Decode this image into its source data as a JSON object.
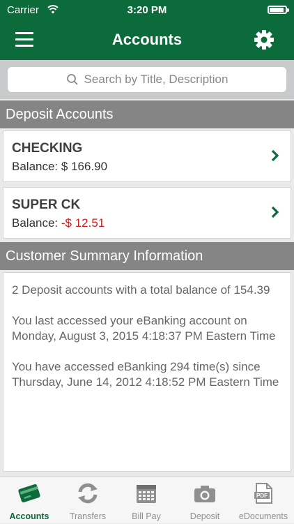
{
  "status_bar": {
    "carrier": "Carrier",
    "time": "3:20 PM",
    "battery_level": 0.9
  },
  "nav": {
    "title": "Accounts"
  },
  "search": {
    "placeholder": "Search by Title, Description"
  },
  "sections": {
    "deposit_accounts": "Deposit Accounts",
    "customer_summary": "Customer Summary Information"
  },
  "accounts": [
    {
      "name": "CHECKING",
      "balance_label": "Balance: ",
      "balance_value": "$ 166.90"
    },
    {
      "name": "SUPER CK",
      "balance_label": "Balance: ",
      "balance_value": "-$ 12.51"
    }
  ],
  "summary": {
    "line1": "2 Deposit accounts with a total balance of 154.39",
    "line2": "You last accessed your eBanking account on Monday, August 3, 2015 4:18:37 PM Eastern Time",
    "line3": "You have accessed eBanking 294 time(s) since Thursday, June 14, 2012 4:18:52 PM Eastern Time"
  },
  "tabs": [
    {
      "label": "Accounts",
      "icon": "accounts-card-icon",
      "active": true
    },
    {
      "label": "Transfers",
      "icon": "transfer-arrows-icon"
    },
    {
      "label": "Bill Pay",
      "icon": "calendar-icon"
    },
    {
      "label": "Deposit",
      "icon": "camera-icon"
    },
    {
      "label": "eDocuments",
      "icon": "pdf-document-icon"
    }
  ],
  "colors": {
    "brand_green": "#0b6b3a",
    "negative_red": "#d31a1a",
    "section_gray": "#858585"
  }
}
